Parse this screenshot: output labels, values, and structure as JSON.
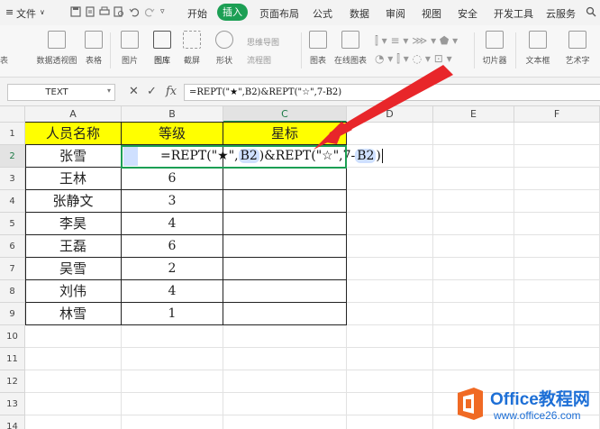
{
  "menubar": {
    "hamburger": "≡",
    "file": "文件",
    "tabs": [
      "开始",
      "插入",
      "页面布局",
      "公式",
      "数据",
      "审阅",
      "视图",
      "安全",
      "开发工具",
      "云服务"
    ],
    "active_tab": "插入",
    "search_icon": "search-icon"
  },
  "ribbon": {
    "pivot_table": "数据透视图",
    "table": "表格",
    "image": "图片",
    "image_lib": "图库",
    "screenshot": "截屏",
    "shapes": "形状",
    "mindmap": "思维导图",
    "flowchart": "流程图",
    "chart": "图表",
    "online_chart": "在线图表",
    "slicer": "切片器",
    "textbox": "文本框",
    "art_text": "艺术字",
    "left_cut": "表"
  },
  "formula_bar": {
    "name_box": "TEXT",
    "cancel_symbol": "✕",
    "confirm_symbol": "✓",
    "fx": "fx",
    "formula": "=REPT(\"★\",B2)&REPT(\"☆\",7-B2)"
  },
  "grid": {
    "columns": [
      "A",
      "B",
      "C",
      "D",
      "E",
      "F"
    ],
    "rows": [
      "1",
      "2",
      "3",
      "4",
      "5",
      "6",
      "7",
      "8",
      "9",
      "10",
      "11",
      "12",
      "13",
      "14"
    ],
    "headers": [
      "人员名称",
      "等级",
      "星标"
    ],
    "data": [
      {
        "name": "张雪",
        "level": ""
      },
      {
        "name": "王林",
        "level": "6"
      },
      {
        "name": "张静文",
        "level": "3"
      },
      {
        "name": "李昊",
        "level": "4"
      },
      {
        "name": "王磊",
        "level": "6"
      },
      {
        "name": "吴雪",
        "level": "2"
      },
      {
        "name": "刘伟",
        "level": "4"
      },
      {
        "name": "林雪",
        "level": "1"
      }
    ],
    "editing": {
      "part1": "=REPT(\"★\",",
      "ref1": "B2",
      "part2": ")&REPT(\"☆\",7-",
      "ref2": "B2",
      "part3": ")"
    }
  },
  "watermark": {
    "title": "Office教程网",
    "url": "www.office26.com"
  },
  "colors": {
    "accent_green": "#1c9f54",
    "header_yellow": "#ffff00",
    "arrow_red": "#e8262a",
    "watermark_blue": "#1d6fd6",
    "watermark_orange": "#f06a24"
  }
}
